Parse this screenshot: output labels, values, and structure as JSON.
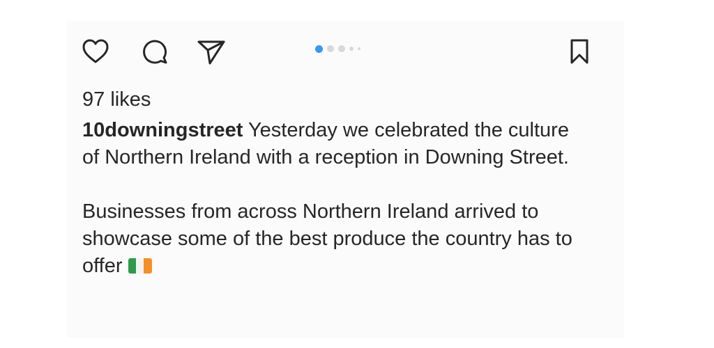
{
  "post": {
    "actions": {
      "like_icon": "heart-icon",
      "comment_icon": "speech-bubble-icon",
      "share_icon": "paper-plane-icon",
      "save_icon": "bookmark-icon"
    },
    "carousel": {
      "total_dots": 5,
      "active_index": 1,
      "active_color": "#3897f0",
      "inactive_color": "#d8d8d8"
    },
    "likes": "97 likes",
    "caption": {
      "username": "10downingstreet",
      "paragraph_1_text": " Yesterday we celebrated the culture of Northern Ireland with a reception in Downing Street.",
      "paragraph_2_text": "Businesses from across Northern Ireland arrived to showcase some of the best produce the country has to offer",
      "emoji": "irish-flag-emoji"
    }
  }
}
